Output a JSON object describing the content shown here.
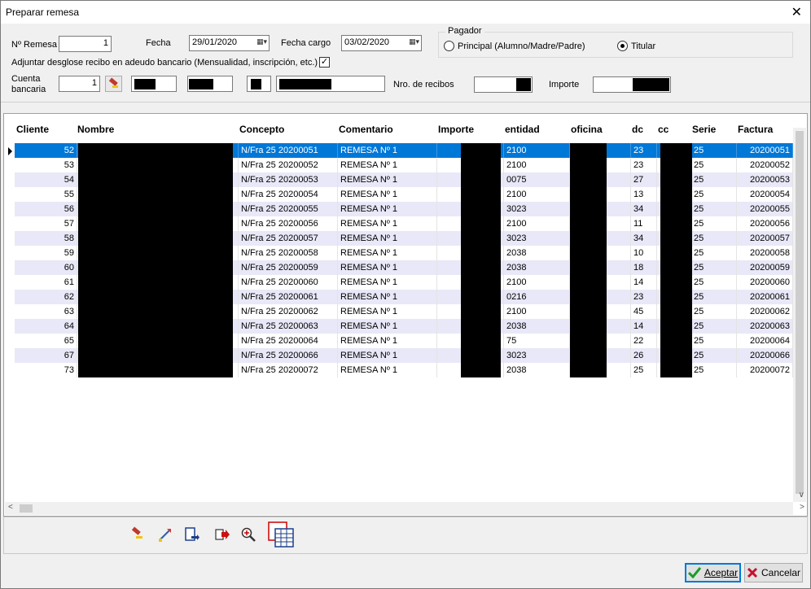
{
  "window": {
    "title": "Preparar remesa",
    "close": "✕"
  },
  "form": {
    "remesa_label": "Nº Remesa",
    "remesa_value": "1",
    "fecha_label": "Fecha",
    "fecha_value": "29/01/2020",
    "fecha_cargo_label": "Fecha cargo",
    "fecha_cargo_value": "03/02/2020",
    "adjuntar_label": "Adjuntar desglose recibo en adeudo bancario (Mensualidad, inscripción, etc.)",
    "adjuntar_checked": "✓",
    "cuenta_label_1": "Cuenta",
    "cuenta_label_2": "bancaria",
    "cuenta_value": "1",
    "nro_recibos_label": "Nro. de recibos",
    "importe_label": "Importe"
  },
  "pagador": {
    "title": "Pagador",
    "option_principal": "Principal (Alumno/Madre/Padre)",
    "option_titular": "Titular",
    "selected": "titular"
  },
  "grid": {
    "columns": [
      "Cliente",
      "Nombre",
      "Concepto",
      "Comentario",
      "Importe",
      "entidad",
      "oficina",
      "dc",
      "cc",
      "Serie",
      "Factura"
    ],
    "rows": [
      {
        "cliente": "52",
        "concepto": "N/Fra 25 20200051",
        "comentario": "REMESA Nº 1",
        "entidad": "2100",
        "dc": "23",
        "serie": "25",
        "factura": "20200051"
      },
      {
        "cliente": "53",
        "concepto": "N/Fra 25 20200052",
        "comentario": "REMESA Nº 1",
        "entidad": "2100",
        "dc": "23",
        "serie": "25",
        "factura": "20200052"
      },
      {
        "cliente": "54",
        "concepto": "N/Fra 25 20200053",
        "comentario": "REMESA Nº 1",
        "entidad": "0075",
        "dc": "27",
        "serie": "25",
        "factura": "20200053"
      },
      {
        "cliente": "55",
        "concepto": "N/Fra 25 20200054",
        "comentario": "REMESA Nº 1",
        "entidad": "2100",
        "dc": "13",
        "serie": "25",
        "factura": "20200054"
      },
      {
        "cliente": "56",
        "concepto": "N/Fra 25 20200055",
        "comentario": "REMESA Nº 1",
        "entidad": "3023",
        "dc": "34",
        "serie": "25",
        "factura": "20200055"
      },
      {
        "cliente": "57",
        "concepto": "N/Fra 25 20200056",
        "comentario": "REMESA Nº 1",
        "entidad": "2100",
        "dc": "11",
        "serie": "25",
        "factura": "20200056"
      },
      {
        "cliente": "58",
        "concepto": "N/Fra 25 20200057",
        "comentario": "REMESA Nº 1",
        "entidad": "3023",
        "dc": "34",
        "serie": "25",
        "factura": "20200057"
      },
      {
        "cliente": "59",
        "concepto": "N/Fra 25 20200058",
        "comentario": "REMESA Nº 1",
        "entidad": "2038",
        "dc": "10",
        "serie": "25",
        "factura": "20200058"
      },
      {
        "cliente": "60",
        "concepto": "N/Fra 25 20200059",
        "comentario": "REMESA Nº 1",
        "entidad": "2038",
        "dc": "18",
        "serie": "25",
        "factura": "20200059"
      },
      {
        "cliente": "61",
        "concepto": "N/Fra 25 20200060",
        "comentario": "REMESA Nº 1",
        "entidad": "2100",
        "dc": "14",
        "serie": "25",
        "factura": "20200060"
      },
      {
        "cliente": "62",
        "concepto": "N/Fra 25 20200061",
        "comentario": "REMESA Nº 1",
        "entidad": "0216",
        "dc": "23",
        "serie": "25",
        "factura": "20200061"
      },
      {
        "cliente": "63",
        "concepto": "N/Fra 25 20200062",
        "comentario": "REMESA Nº 1",
        "entidad": "2100",
        "dc": "45",
        "serie": "25",
        "factura": "20200062"
      },
      {
        "cliente": "64",
        "concepto": "N/Fra 25 20200063",
        "comentario": "REMESA Nº 1",
        "entidad": "2038",
        "dc": "14",
        "serie": "25",
        "factura": "20200063"
      },
      {
        "cliente": "65",
        "concepto": "N/Fra 25 20200064",
        "comentario": "REMESA Nº 1",
        "entidad": "75",
        "dc": "22",
        "serie": "25",
        "factura": "20200064"
      },
      {
        "cliente": "67",
        "concepto": "N/Fra 25 20200066",
        "comentario": "REMESA Nº 1",
        "entidad": "3023",
        "dc": "26",
        "serie": "25",
        "factura": "20200066"
      },
      {
        "cliente": "73",
        "concepto": "N/Fra 25 20200072",
        "comentario": "REMESA Nº 1",
        "entidad": "2038",
        "dc": "25",
        "serie": "25",
        "factura": "20200072"
      }
    ]
  },
  "toolbar": {
    "icons": [
      "eraser-icon",
      "edit-arrow-icon",
      "export-document-icon",
      "print-export-icon",
      "zoom-icon",
      "spreadsheet-icon"
    ]
  },
  "buttons": {
    "accept": "Aceptar",
    "cancel": "Cancelar"
  },
  "colors": {
    "selection": "#0078d7",
    "alt_row": "#e8e8f8",
    "accept_icon": "#1a9c2a",
    "cancel_icon": "#c8102e"
  }
}
